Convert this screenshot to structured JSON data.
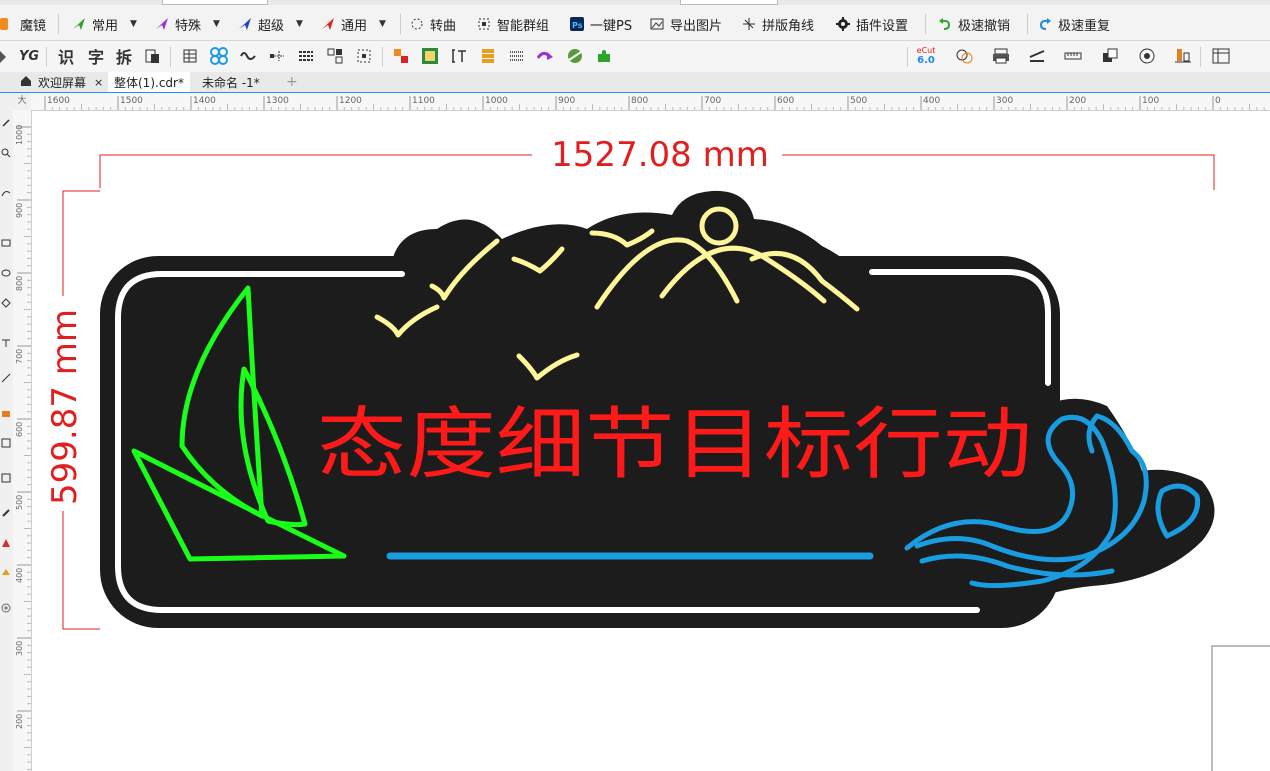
{
  "menubar": {
    "items": [
      {
        "label": "魔镜",
        "icon": "magic-mirror-icon",
        "color": "#f08a1c"
      },
      {
        "label": "常用",
        "icon": "paper-plane-green-icon",
        "color": "#2aa62a",
        "dropdown": true
      },
      {
        "label": "特殊",
        "icon": "paper-plane-purple-icon",
        "color": "#9b30d9",
        "dropdown": true
      },
      {
        "label": "超级",
        "icon": "paper-plane-blue-icon",
        "color": "#2244cc",
        "dropdown": true
      },
      {
        "label": "通用",
        "icon": "paper-plane-red-icon",
        "color": "#e02020",
        "dropdown": true
      },
      {
        "label": "转曲",
        "icon": "convert-curve-icon"
      },
      {
        "label": "智能群组",
        "icon": "smart-group-icon"
      },
      {
        "label": "一键PS",
        "icon": "photoshop-icon"
      },
      {
        "label": "导出图片",
        "icon": "export-image-icon"
      },
      {
        "label": "拼版角线",
        "icon": "crop-marks-icon"
      },
      {
        "label": "插件设置",
        "icon": "gear-icon"
      },
      {
        "label": "极速撤销",
        "icon": "undo-icon",
        "color": "#2aa62a"
      },
      {
        "label": "极速重复",
        "icon": "redo-icon",
        "color": "#1e88e5"
      }
    ]
  },
  "toolbar2": {
    "text_buttons": [
      "YG",
      "识",
      "字",
      "拆"
    ],
    "cut_badge": {
      "top": "eCut",
      "bottom": "6.0"
    }
  },
  "tabs": [
    {
      "label": "欢迎屏幕",
      "closable": true,
      "close_glyph": "×"
    },
    {
      "label": "整体(1).cdr*",
      "active": true
    },
    {
      "label": "未命名 -1*"
    },
    {
      "label": "+"
    }
  ],
  "ruler": {
    "corner_glyph": "大",
    "horizontal_ticks": [
      "1600",
      "1500",
      "1400",
      "1300",
      "1200",
      "1100",
      "1000",
      "900",
      "800",
      "700",
      "600",
      "500",
      "400",
      "300",
      "200",
      "100",
      "0"
    ],
    "vertical_ticks": [
      "1000",
      "900",
      "800",
      "700",
      "600",
      "500",
      "400",
      "300",
      "200"
    ]
  },
  "design": {
    "width_label": "1527.08 mm",
    "height_label": "599.87 mm",
    "title": "态度细节目标行动",
    "colors": {
      "background": "#1c1c1c",
      "border": "#ffffff",
      "sailboat": "#1aff1a",
      "birds_mountains": "#fff59a",
      "title": "#ff1a1a",
      "waves": "#1a9ce0",
      "dimension": "#e02020"
    }
  }
}
